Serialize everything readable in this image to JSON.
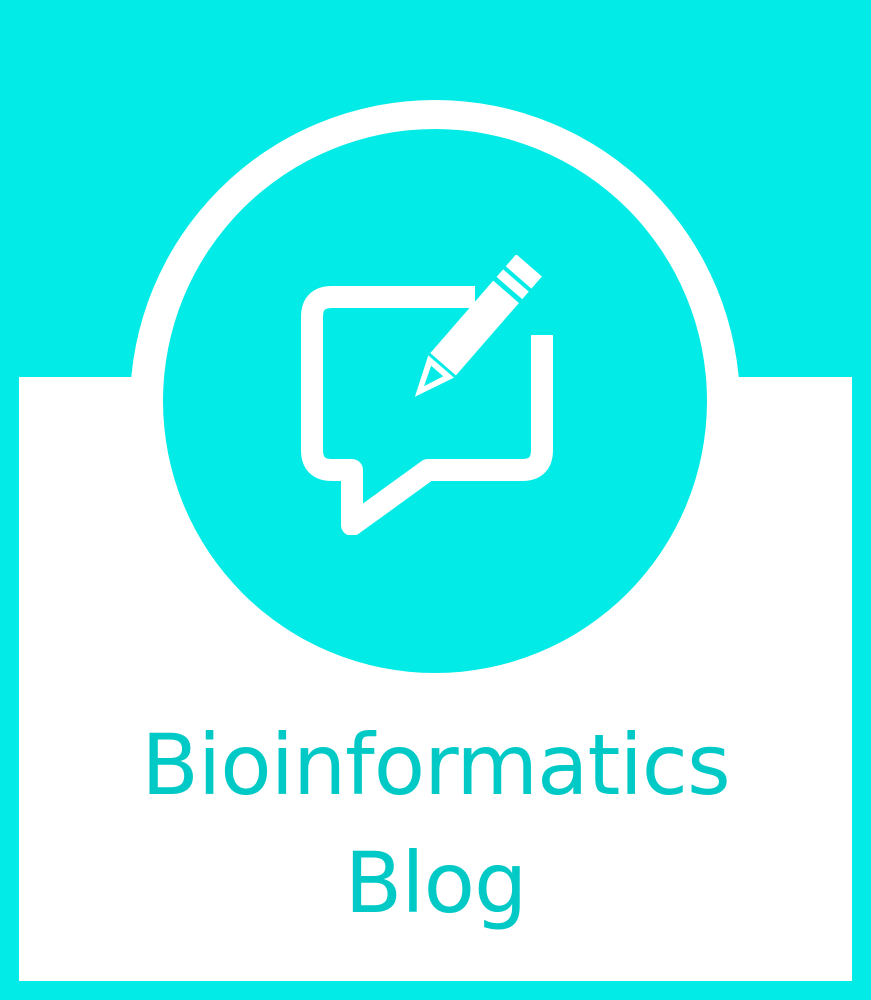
{
  "title": {
    "line1": "Bioinformatics",
    "line2": "Blog"
  },
  "icon": {
    "name": "chat-bubble-pencil-icon"
  },
  "colors": {
    "background": "#03EBE6",
    "panel": "#FFFFFF",
    "text": "#00C9C6",
    "icon": "#FFFFFF"
  }
}
